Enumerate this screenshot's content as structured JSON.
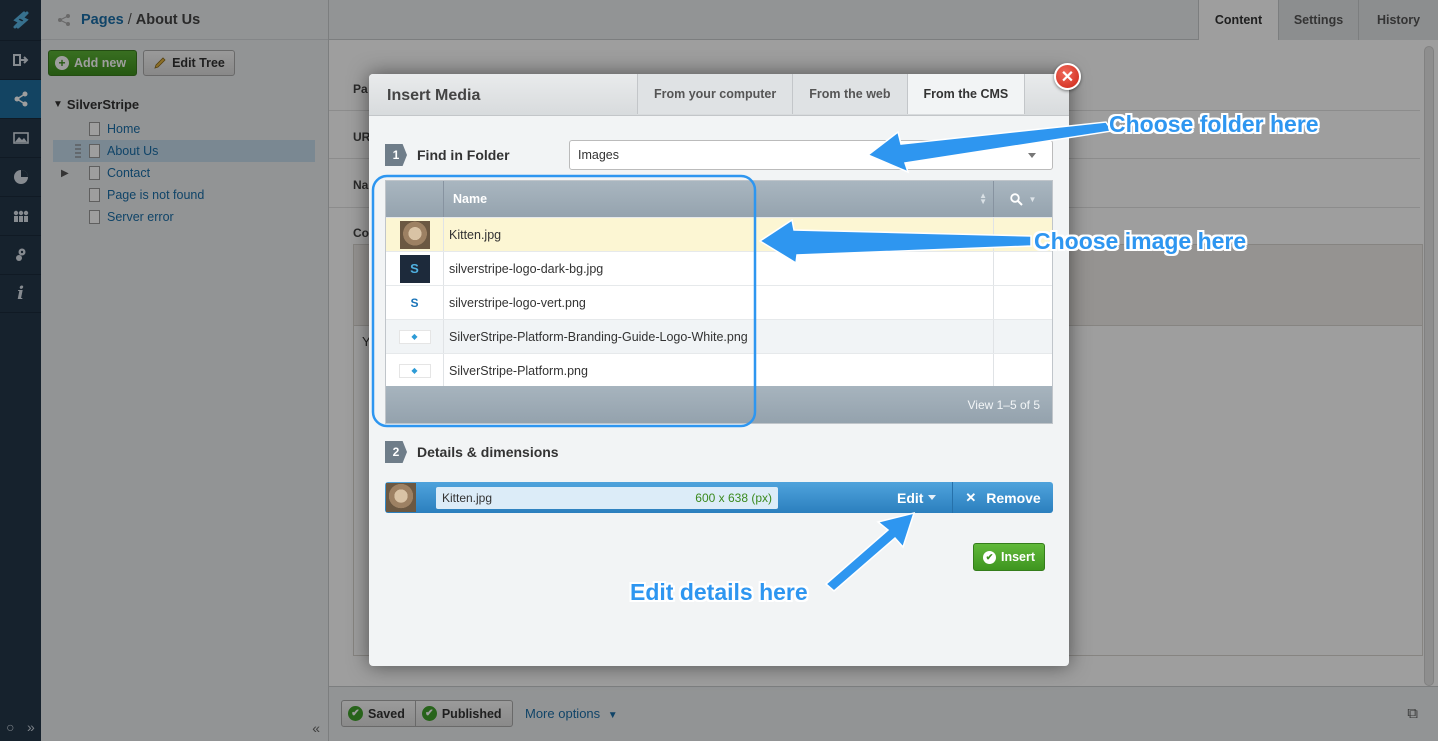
{
  "breadcrumb": {
    "root": "Pages",
    "separator": "/",
    "current": "About Us"
  },
  "main_tabs": [
    "Content",
    "Settings",
    "History"
  ],
  "tree_toolbar": {
    "add_new": "Add new",
    "edit_tree": "Edit Tree"
  },
  "tree": {
    "root": "SilverStripe",
    "items": [
      "Home",
      "About Us",
      "Contact",
      "Page is not found",
      "Server error"
    ]
  },
  "form_bg": {
    "labels": [
      "Pa",
      "UR",
      "Na",
      "Co"
    ],
    "content_letter": "Y"
  },
  "bottom": {
    "saved": "Saved",
    "published": "Published",
    "more_options": "More options"
  },
  "modal": {
    "title": "Insert Media",
    "tabs": [
      "From your computer",
      "From the web",
      "From the CMS"
    ],
    "active_tab": "From the CMS",
    "step1": {
      "num": "1",
      "label": "Find in Folder"
    },
    "folder_value": "Images",
    "grid": {
      "header_name": "Name",
      "rows": [
        {
          "name": "Kitten.jpg",
          "thumb": "kitten"
        },
        {
          "name": "silverstripe-logo-dark-bg.jpg",
          "thumb": "dark"
        },
        {
          "name": "silverstripe-logo-vert.png",
          "thumb": "vert"
        },
        {
          "name": "SilverStripe-Platform-Branding-Guide-Logo-White.png",
          "thumb": "wide"
        },
        {
          "name": "SilverStripe-Platform.png",
          "thumb": "wide"
        }
      ],
      "footer": "View 1–5 of 5"
    },
    "step2": {
      "num": "2",
      "label": "Details & dimensions"
    },
    "detail": {
      "filename": "Kitten.jpg",
      "dimensions": "600 x 638 (px)",
      "edit": "Edit",
      "remove": "Remove"
    },
    "insert": "Insert"
  },
  "annotations": {
    "folder": "Choose folder here",
    "image": "Choose image here",
    "edit": "Edit details here"
  },
  "colors": {
    "annotation": "#2e96f0",
    "rail": "#24374a",
    "accent_green": "#3d8f1e",
    "link": "#1a6ea8"
  }
}
